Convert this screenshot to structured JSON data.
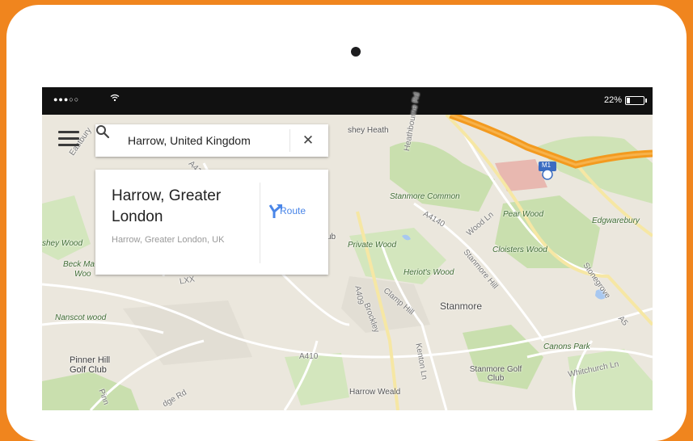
{
  "status_bar": {
    "signal": "●●●○○",
    "wifi_icon": "wifi-icon",
    "battery_percent": "22%",
    "battery_level": 0.22
  },
  "search": {
    "value": "Harrow, United Kingdom",
    "clear_label": "✕"
  },
  "result": {
    "title": "Harrow, Greater London",
    "subtitle": "Harrow, Greater London, UK",
    "route_label": "Route"
  },
  "map_labels": {
    "heath": "shey Heath",
    "road_a": "Heathbourne Rd",
    "stanmore_common": "Stanmore Common",
    "pear_wood": "Pear Wood",
    "edgwarebury": "Edgwarebury",
    "motorway": "M1",
    "a4140": "A4140",
    "wood_ln": "Wood Ln",
    "private_wood": "Private Wood",
    "cloisters_wood": "Cloisters Wood",
    "stanmore_hill": "Stanmore Hill",
    "heriots_wood": "Heriot's Wood",
    "stanmore": "Stanmore",
    "a409": "A409",
    "brockley": "Brockley",
    "clamp_hill": "Clamp Hill",
    "stonegrove": "Stonegrove",
    "a5": "A5",
    "canons_park": "Canons Park",
    "whitchurch_ln": "Whitchurch Ln",
    "a410": "A410",
    "kenton_ln": "Kenton Ln",
    "stanmore_golf": "Stanmore Golf Club",
    "harrow_weald": "Harrow Weald",
    "pinner_hill": "Pinner Hill Golf Club",
    "nanscot_wood": "Nanscot wood",
    "beck_ma": "Beck Ma",
    "woo": "Woo",
    "shey_wood": "shey Wood",
    "eastbury": "Eastbury",
    "a41": "A41",
    "lxx": "LXX",
    "uxbridge_rd": "dge Rd",
    "pinn": "Pinn",
    "ub": "ub"
  }
}
